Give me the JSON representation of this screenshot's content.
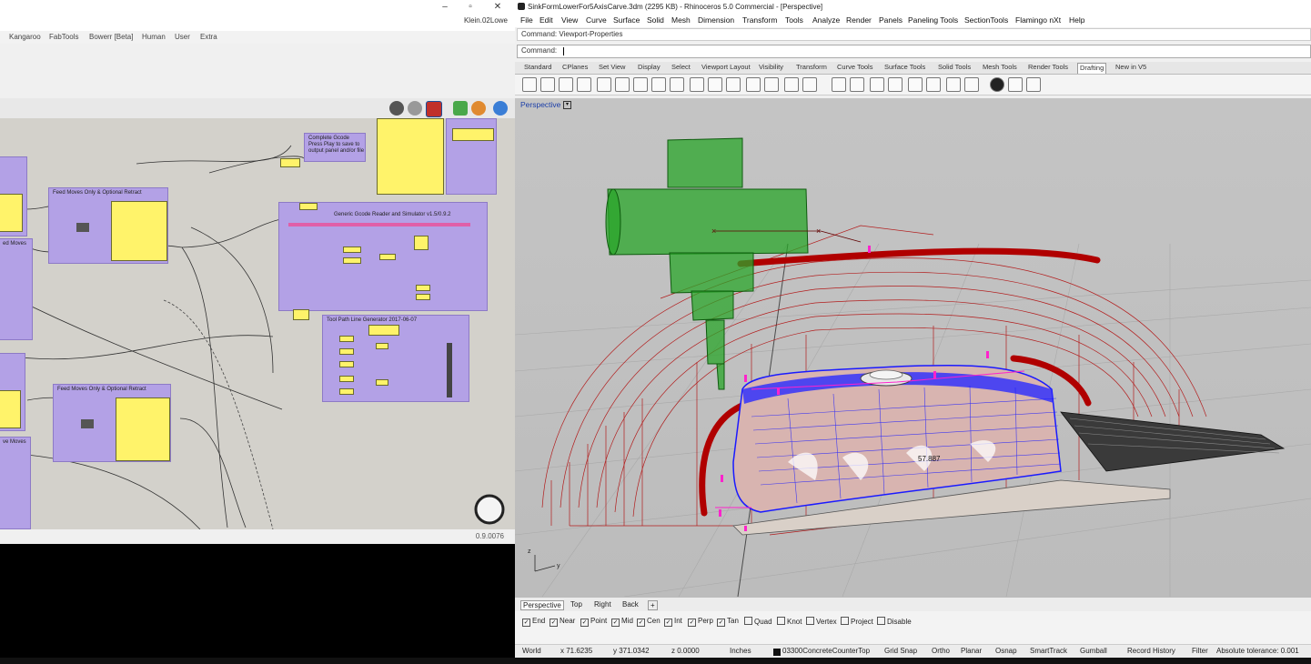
{
  "grasshopper": {
    "window_title": "Klein.02Lowe",
    "menu_tabs": [
      "Kangaroo",
      "FabTools",
      "Bowerr [Beta]",
      "Human",
      "User",
      "Extra"
    ],
    "version": "0.9.0076",
    "groups": [
      {
        "title": "Feed Moves Only & Optional Retract"
      },
      {
        "title": "Feed Moves Only & Optional Retract"
      },
      {
        "title": "Complete Gcode\nPress Play to save to\noutput panel and/or file"
      },
      {
        "title": "Generic Gcode Reader and Simulator  v1.5/0.9.2"
      },
      {
        "title": "Tool Path Line Generator 2017-06-07"
      },
      {
        "title": "ed Moves"
      },
      {
        "title": "ve Moves"
      }
    ]
  },
  "rhino": {
    "window_title": "SinkFormLowerFor5AxisCarve.3dm (2295 KB) - Rhinoceros 5.0 Commercial - [Perspective]",
    "menu": [
      "File",
      "Edit",
      "View",
      "Curve",
      "Surface",
      "Solid",
      "Mesh",
      "Dimension",
      "Transform",
      "Tools",
      "Analyze",
      "Render",
      "Panels",
      "Paneling Tools",
      "SectionTools",
      "Flamingo nXt",
      "Help"
    ],
    "command_history": "Command: Viewport-Properties",
    "command_prompt": "Command:",
    "toolbar_tabs": [
      "Standard",
      "CPlanes",
      "Set View",
      "Display",
      "Select",
      "Viewport Layout",
      "Visibility",
      "Transform",
      "Curve Tools",
      "Surface Tools",
      "Solid Tools",
      "Mesh Tools",
      "Render Tools",
      "Drafting",
      "New in V5"
    ],
    "active_toolbar_tab": "Drafting",
    "viewport_label": "Perspective",
    "dimension_text": "57.887",
    "viewport_tabs": [
      "Perspective",
      "Top",
      "Right",
      "Back"
    ],
    "add_viewport_glyph": "+",
    "osnaps": [
      {
        "label": "End",
        "checked": true
      },
      {
        "label": "Near",
        "checked": true
      },
      {
        "label": "Point",
        "checked": true
      },
      {
        "label": "Mid",
        "checked": true
      },
      {
        "label": "Cen",
        "checked": true
      },
      {
        "label": "Int",
        "checked": true
      },
      {
        "label": "Perp",
        "checked": true
      },
      {
        "label": "Tan",
        "checked": true
      },
      {
        "label": "Quad",
        "checked": false
      },
      {
        "label": "Knot",
        "checked": false
      },
      {
        "label": "Vertex",
        "checked": false
      },
      {
        "label": "Project",
        "checked": false
      },
      {
        "label": "Disable",
        "checked": false
      }
    ],
    "status": {
      "cplane": "World",
      "x": "x 71.6235",
      "y": "y 371.0342",
      "z": "z 0.0000",
      "units": "Inches",
      "layer": "03300ConcreteCounterTop",
      "grid_snap": "Grid Snap",
      "ortho": "Ortho",
      "planar": "Planar",
      "osnap": "Osnap",
      "smarttrack": "SmartTrack",
      "gumball": "Gumball",
      "record_history": "Record History",
      "filter": "Filter",
      "tolerance": "Absolute tolerance: 0.001"
    }
  },
  "colors": {
    "cluster_fill": "#b3a1e6",
    "panel_fill": "#fff36a",
    "gh_canvas": "#d3d1cb",
    "toolpath_red": "#b00000",
    "head_green": "#2aa62a",
    "part_blue": "#1a1aff",
    "label_blue": "#1b3ea8"
  }
}
